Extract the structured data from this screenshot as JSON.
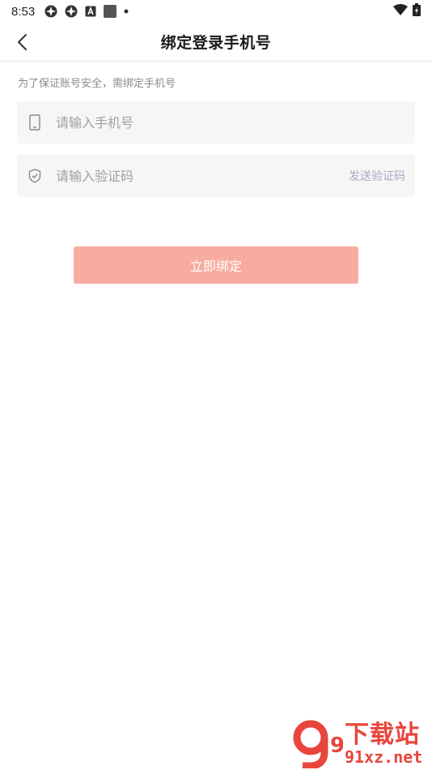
{
  "status_bar": {
    "time": "8:53",
    "left_icons": [
      "app-icon-1",
      "app-icon-2",
      "font-icon",
      "square-icon",
      "dot-icon"
    ],
    "right_icons": [
      "wifi-icon",
      "battery-icon"
    ]
  },
  "nav": {
    "title": "绑定登录手机号",
    "back_icon": "back-arrow-icon"
  },
  "hint": "为了保证账号安全，需绑定手机号",
  "phone_field": {
    "icon": "phone-icon",
    "placeholder": "请输入手机号",
    "value": ""
  },
  "code_field": {
    "icon": "shield-icon",
    "placeholder": "请输入验证码",
    "value": "",
    "send_label": "发送验证码"
  },
  "submit_label": "立即绑定",
  "watermark": {
    "logo_text": "9",
    "cn": "下载站",
    "url": "91xz.net"
  },
  "colors": {
    "button": "#f8aca0",
    "send_code": "#a9a9c9",
    "watermark": "#e8453c"
  }
}
